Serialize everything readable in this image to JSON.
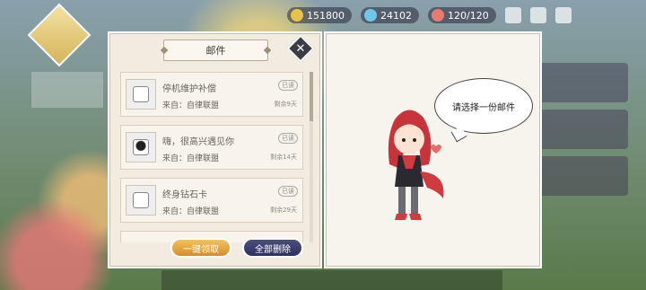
{
  "topbar": {
    "gold": "151800",
    "gems": "24102",
    "stamina": "120/120"
  },
  "dialog": {
    "title": "邮件",
    "close_icon": "close-icon",
    "mails": [
      {
        "title": "停机维护补偿",
        "sender": "来自：自律联盟",
        "badge": "已读",
        "remain": "剩余9天",
        "icon": "gift-icon"
      },
      {
        "title": "嗨，很高兴遇见你",
        "sender": "来自：自律联盟",
        "badge": "已读",
        "remain": "剩余14天",
        "icon": "character-icon"
      },
      {
        "title": "终身钻石卡",
        "sender": "来自：自律联盟",
        "badge": "已读",
        "remain": "剩余29天",
        "icon": "gift-icon"
      }
    ],
    "buttons": {
      "claim_all": "一键领取",
      "delete_all": "全部删除"
    },
    "prompt": "请选择一份邮件"
  }
}
